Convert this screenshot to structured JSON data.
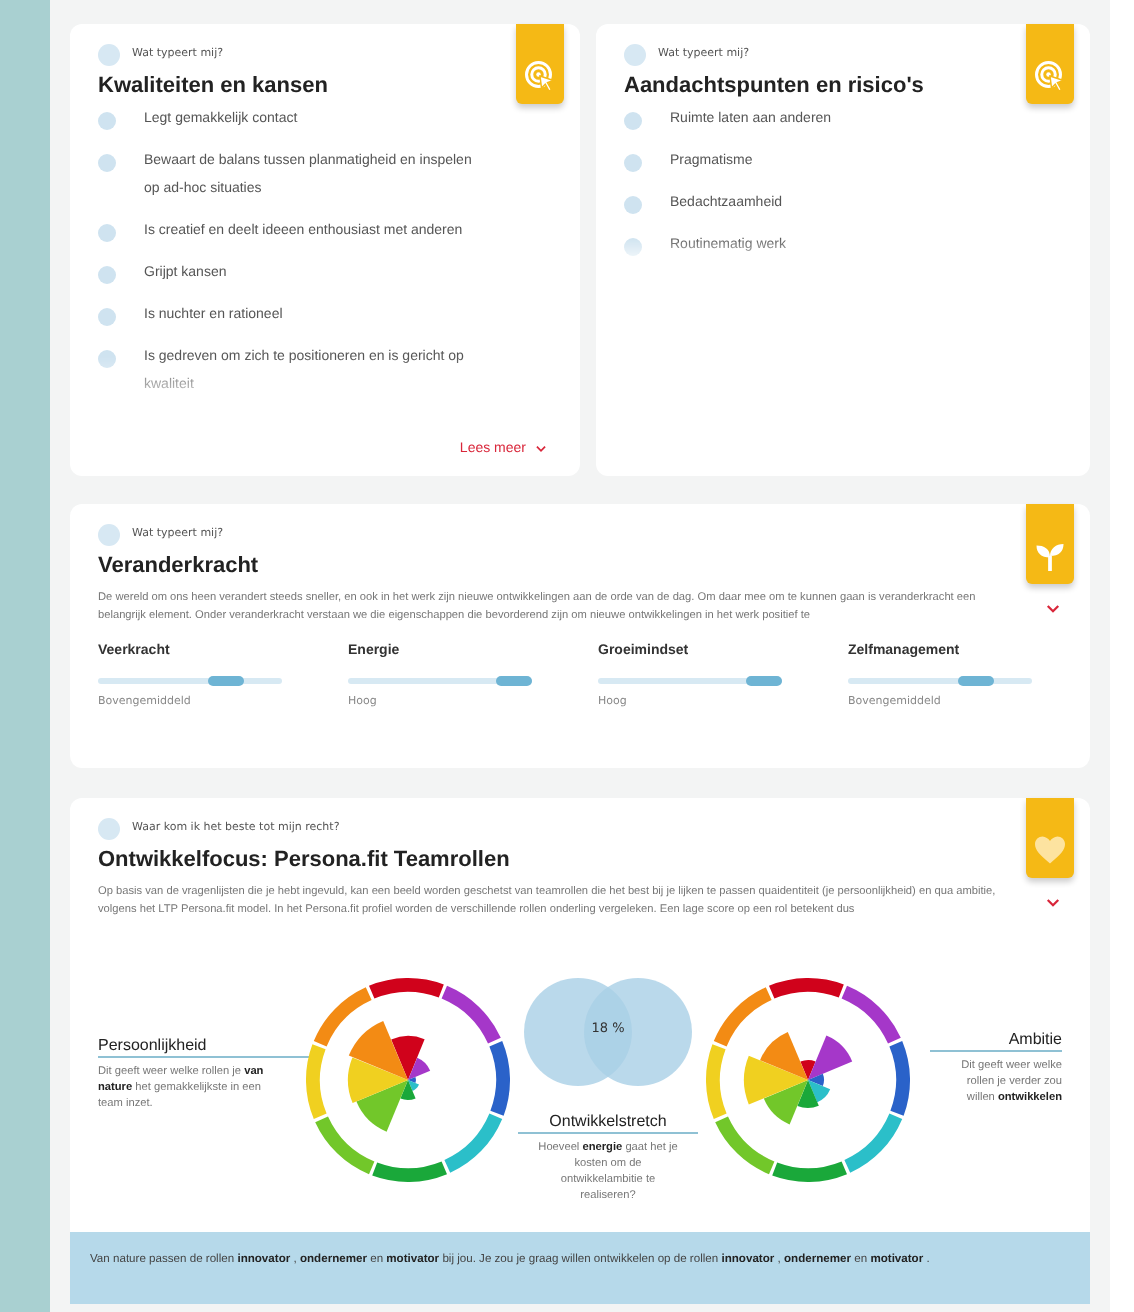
{
  "cards": [
    {
      "kicker": "Wat typeert mij?",
      "title": "Kwaliteiten en kansen",
      "items": [
        "Legt gemakkelijk contact",
        "Bewaart de balans tussen planmatigheid en inspelen op ad-hoc situaties",
        "Is creatief en deelt ideeen enthousiast met anderen",
        "Grijpt kansen",
        "Is nuchter en rationeel",
        "Is gedreven om zich te positioneren en is gericht op kwaliteit"
      ],
      "more_link": "Lees meer"
    },
    {
      "kicker": "Wat typeert mij?",
      "title": "Aandachtspunten en risico's",
      "items": [
        "Ruimte laten aan anderen",
        "Pragmatisme",
        "Bedachtzaamheid",
        "Routinematig werk"
      ]
    }
  ],
  "change_power": {
    "kicker": "Wat typeert mij?",
    "title": "Veranderkracht",
    "description": "De wereld om ons heen verandert steeds sneller, en ook in het werk zijn nieuwe ontwikkelingen aan de orde van de dag. Om daar mee om te kunnen gaan is veranderkracht een belangrijk element. Onder veranderkracht verstaan we die eigenschappen die bevorderend zijn om nieuwe ontwikkelingen in het werk positief te",
    "meters": [
      {
        "name": "Veerkracht",
        "level": 0.7,
        "reading": "Bovengemiddeld"
      },
      {
        "name": "Energie",
        "level": 0.9,
        "reading": "Hoog"
      },
      {
        "name": "Groeimindset",
        "level": 0.9,
        "reading": "Hoog"
      },
      {
        "name": "Zelfmanagement",
        "level": 0.7,
        "reading": "Bovengemiddeld"
      }
    ]
  },
  "development_focus": {
    "kicker": "Waar kom ik het beste tot mijn recht?",
    "title": "Ontwikkelfocus: Persona.fit Teamrollen",
    "description": "Op basis van de vragenlijsten die je hebt ingevuld, kan een beeld worden geschetst van teamrollen die het best bij je lijken te passen quaidentiteit (je persoonlijkheid) en qua ambitie, volgens het LTP Persona.fit model. In het Persona.fit profiel worden de verschillende rollen onderling vergeleken. Een lage score op een rol betekent dus",
    "personality": {
      "title": "Persoonlijkheid",
      "text": "Dit geeft weer welke rollen je **van nature** het gemakkelijkste in een team inzet."
    },
    "stretch": {
      "value": "18 %",
      "title": "Ontwikkelstretch",
      "text": "Hoeveel **energie** gaat het je kosten om de ontwikkelambitie te realiseren?"
    },
    "ambition": {
      "title": "Ambitie",
      "text": "Dit geeft weer welke rollen je verder zou willen **ontwikkelen**"
    },
    "summary": "Van nature passen de rollen **innovator** , **ondernemer** en **motivator** bij jou. Je zou je graag willen ontwikkelen op de rollen **innovator** , **ondernemer** en **motivator** ."
  }
}
